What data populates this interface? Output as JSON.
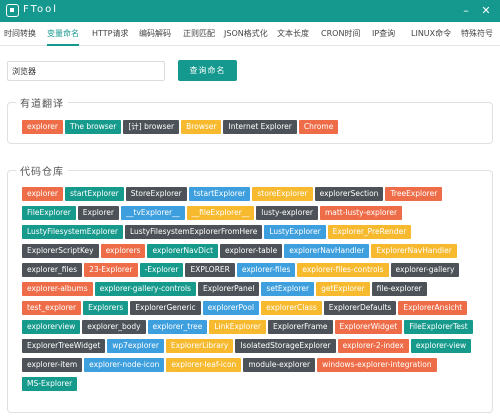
{
  "app": {
    "title": "FTool",
    "min_glyph": "–",
    "close_glyph": "✕"
  },
  "tabs": [
    {
      "label": "时间转换",
      "active": false
    },
    {
      "label": "变量命名",
      "active": true
    },
    {
      "label": "HTTP请求",
      "active": false
    },
    {
      "label": "编码解码",
      "active": false
    },
    {
      "label": "正则匹配",
      "active": false
    },
    {
      "label": "JSON格式化",
      "active": false
    },
    {
      "label": "文本长度",
      "active": false
    },
    {
      "label": "CRON时间",
      "active": false
    },
    {
      "label": "IP查询",
      "active": false
    },
    {
      "label": "LINUX命令",
      "active": false
    },
    {
      "label": "特殊符号",
      "active": false
    }
  ],
  "search": {
    "value": "浏览器",
    "button_label": "查询命名"
  },
  "translation": {
    "title": "有道翻译",
    "tags": [
      {
        "text": "explorer",
        "color": "orange"
      },
      {
        "text": "The browser",
        "color": "teal"
      },
      {
        "text": "[计] browser",
        "color": "dark"
      },
      {
        "text": "Browser",
        "color": "yellow"
      },
      {
        "text": "Internet Explorer",
        "color": "dark"
      },
      {
        "text": "Chrome",
        "color": "orange"
      }
    ]
  },
  "repository": {
    "title": "代码仓库",
    "tags": [
      {
        "text": "explorer",
        "color": "orange"
      },
      {
        "text": "startExplorer",
        "color": "teal"
      },
      {
        "text": "StoreExplorer",
        "color": "dark"
      },
      {
        "text": "tstartExplorer",
        "color": "blue"
      },
      {
        "text": "storeExplorer",
        "color": "yellow"
      },
      {
        "text": "explorerSection",
        "color": "dark"
      },
      {
        "text": "TreeExplorer",
        "color": "orange"
      },
      {
        "text": "FileExplorer",
        "color": "teal"
      },
      {
        "text": "Explorer",
        "color": "dark"
      },
      {
        "text": "__tvExplorer__",
        "color": "blue"
      },
      {
        "text": "__fileExplorer__",
        "color": "yellow"
      },
      {
        "text": "lusty-explorer",
        "color": "dark"
      },
      {
        "text": "matt-lusty-explorer",
        "color": "orange"
      },
      {
        "text": "LustyFilesystemExplorer",
        "color": "teal"
      },
      {
        "text": "LustyFilesystemExplorerFromHere",
        "color": "dark"
      },
      {
        "text": "LustyExplorer",
        "color": "blue"
      },
      {
        "text": "Explorer_PreRender",
        "color": "yellow"
      },
      {
        "text": "ExplorerScriptKey",
        "color": "dark"
      },
      {
        "text": "explorers",
        "color": "orange"
      },
      {
        "text": "explorerNavDict",
        "color": "teal"
      },
      {
        "text": "explorer-table",
        "color": "dark"
      },
      {
        "text": "explorerNavHandler",
        "color": "blue"
      },
      {
        "text": "ExplorerNavHandler",
        "color": "yellow"
      },
      {
        "text": "explorer_files",
        "color": "dark"
      },
      {
        "text": "23-Explorer",
        "color": "orange"
      },
      {
        "text": "-Explorer",
        "color": "teal"
      },
      {
        "text": "EXPLORER",
        "color": "dark"
      },
      {
        "text": "explorer-files",
        "color": "blue"
      },
      {
        "text": "explorer-files-controls",
        "color": "yellow"
      },
      {
        "text": "explorer-gallery",
        "color": "dark"
      },
      {
        "text": "explorer-albums",
        "color": "orange"
      },
      {
        "text": "explorer-gallery-controls",
        "color": "teal"
      },
      {
        "text": "ExplorerPanel",
        "color": "dark"
      },
      {
        "text": "setExplorer",
        "color": "blue"
      },
      {
        "text": "getExplorer",
        "color": "yellow"
      },
      {
        "text": "file-explorer",
        "color": "dark"
      },
      {
        "text": "test_explorer",
        "color": "orange"
      },
      {
        "text": "Explorers",
        "color": "teal"
      },
      {
        "text": "ExplorerGeneric",
        "color": "dark"
      },
      {
        "text": "explorerPool",
        "color": "blue"
      },
      {
        "text": "explorerClass",
        "color": "yellow"
      },
      {
        "text": "ExplorerDefaults",
        "color": "dark"
      },
      {
        "text": "ExplorerAnsicht",
        "color": "orange"
      },
      {
        "text": "explorerview",
        "color": "teal"
      },
      {
        "text": "explorer_body",
        "color": "dark"
      },
      {
        "text": "explorer_tree",
        "color": "blue"
      },
      {
        "text": "LinkExplorer",
        "color": "yellow"
      },
      {
        "text": "ExplorerFrame",
        "color": "dark"
      },
      {
        "text": "ExplorerWidget",
        "color": "orange"
      },
      {
        "text": "FileExplorerTest",
        "color": "teal"
      },
      {
        "text": "ExplorerTreeWidget",
        "color": "dark"
      },
      {
        "text": "wp7explorer",
        "color": "blue"
      },
      {
        "text": "ExplorerLibrary",
        "color": "yellow"
      },
      {
        "text": "IsolatedStorageExplorer",
        "color": "dark"
      },
      {
        "text": "explorer-2-index",
        "color": "orange"
      },
      {
        "text": "explorer-view",
        "color": "teal"
      },
      {
        "text": "explorer-item",
        "color": "dark"
      },
      {
        "text": "explorer-node-icon",
        "color": "blue"
      },
      {
        "text": "explorer-leaf-icon",
        "color": "yellow"
      },
      {
        "text": "module-explorer",
        "color": "dark"
      },
      {
        "text": "windows-explorer-integration",
        "color": "orange"
      },
      {
        "text": "MS-Explorer",
        "color": "teal"
      }
    ]
  },
  "colors": {
    "accent": "#15988e",
    "orange": "#ee6d48",
    "teal": "#169a8c",
    "dark": "#4c5258",
    "yellow": "#f7b92d",
    "blue": "#3d9fde"
  }
}
